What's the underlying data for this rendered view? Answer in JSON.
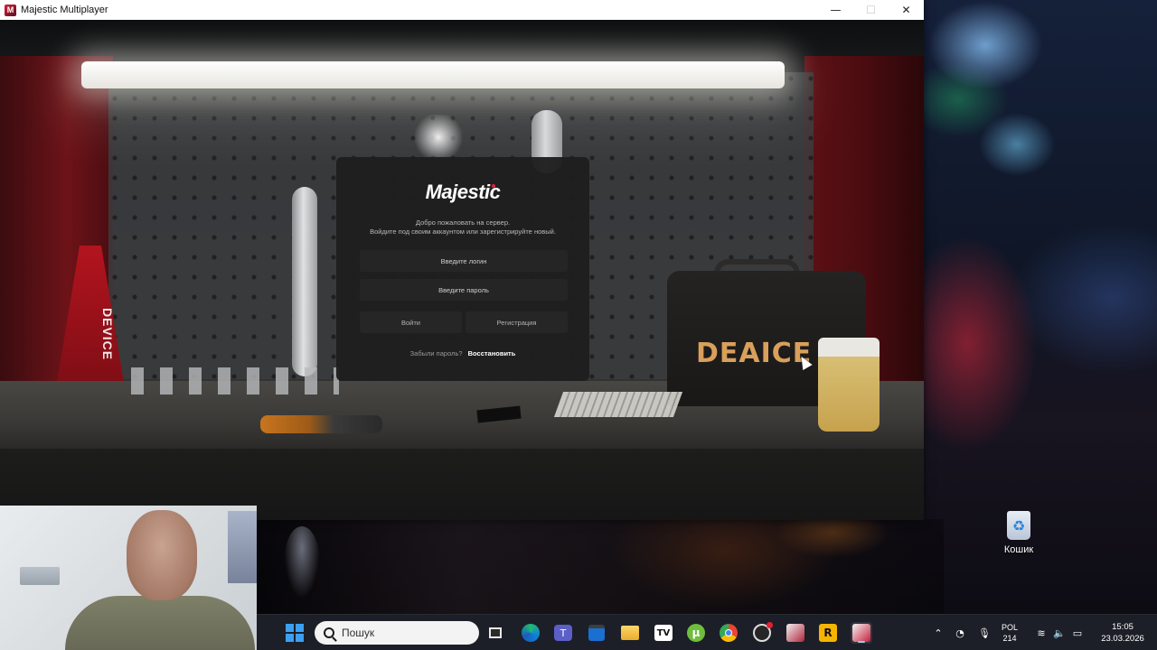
{
  "window": {
    "title": "Majestic Multiplayer",
    "controls": {
      "minimize": "—",
      "maximize": "☐",
      "close": "✕"
    }
  },
  "scene": {
    "jack_label": "DEVICE",
    "case_label": "DEAICE"
  },
  "login": {
    "brand": "Majestic",
    "welcome_line1": "Добро пожаловать на сервер.",
    "welcome_line2": "Войдите под своим аккаунтом или зарегистрируйте новый.",
    "login_placeholder": "Введите логин",
    "password_placeholder": "Введите пароль",
    "enter_label": "Войти",
    "register_label": "Регистрация",
    "forgot_question": "Забыли пароль?",
    "restore_label": "Восстановить"
  },
  "desktop": {
    "recycle_bin_label": "Кошик"
  },
  "taskbar": {
    "search_placeholder": "Пошук",
    "apps": [
      "task-view",
      "edge",
      "teams",
      "store",
      "file-explorer",
      "tradingview",
      "utorrent",
      "chrome",
      "obs",
      "game-app",
      "rockstar",
      "majestic"
    ],
    "tray": {
      "lang_line1": "POL",
      "lang_line2": "214",
      "time": "15:05",
      "date": "23.03.2026"
    }
  },
  "colors": {
    "accent_red": "#e3213d",
    "panel_bg": "#1e1e1f",
    "field_bg": "#252526",
    "taskbar_bg": "#1e2128"
  }
}
